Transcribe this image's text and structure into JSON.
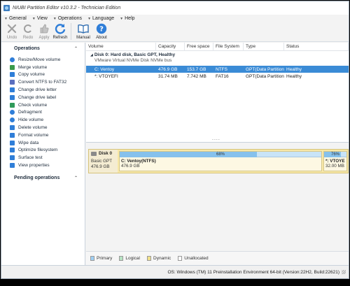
{
  "window": {
    "title": "NIUBI Partition Editor v10.3.2 - Technician Edition"
  },
  "menu": [
    {
      "label": "General"
    },
    {
      "label": "View"
    },
    {
      "label": "Operations"
    },
    {
      "label": "Language"
    },
    {
      "label": "Help"
    }
  ],
  "toolbar": {
    "undo": "Undo",
    "redo": "Redo",
    "apply": "Apply",
    "refresh": "Refresh",
    "manual": "Manual",
    "about": "About"
  },
  "operations_panel": {
    "title": "Operations",
    "items": [
      {
        "label": "Resize/Move volume",
        "color": "#2f7ed8"
      },
      {
        "label": "Merge volume",
        "color": "#3a9a4a"
      },
      {
        "label": "Copy volume",
        "color": "#2f7ed8"
      },
      {
        "label": "Convert NTFS to FAT32",
        "color": "#5a6fbf"
      },
      {
        "label": "Change drive letter",
        "color": "#2f7ed8"
      },
      {
        "label": "Change drive label",
        "color": "#2f7ed8"
      },
      {
        "label": "Check volume",
        "color": "#2f9a5a"
      },
      {
        "label": "Defragment",
        "color": "#2f7ed8"
      },
      {
        "label": "Hide volume",
        "color": "#2f7ed8"
      },
      {
        "label": "Delete volume",
        "color": "#2f7ed8"
      },
      {
        "label": "Format volume",
        "color": "#2f7ed8"
      },
      {
        "label": "Wipe data",
        "color": "#2f7ed8"
      },
      {
        "label": "Optimize filesystem",
        "color": "#2f7ed8"
      },
      {
        "label": "Surface test",
        "color": "#2f7ed8"
      },
      {
        "label": "View properties",
        "color": "#2f7ed8"
      }
    ]
  },
  "pending_panel": {
    "title": "Pending operations"
  },
  "table": {
    "columns": [
      "Volume",
      "Capacity",
      "Free space",
      "File System",
      "Type",
      "Status"
    ],
    "disk_title": "Disk 0: Hard disk, Basic GPT, Healthy",
    "disk_subtitle": "VMware Virtual NVMe Disk NVMe bus",
    "rows": [
      {
        "volume": "C: Ventoy",
        "capacity": "476.9 GB",
        "free": "153.7 GB",
        "fs": "NTFS",
        "type": "GPT(Data Partition)",
        "status": "Healthy",
        "selected": true
      },
      {
        "volume": "*: VTOYEFI",
        "capacity": "31.74 MB",
        "free": "7.742 MB",
        "fs": "FAT16",
        "type": "GPT(Data Partition)",
        "status": "Healthy",
        "selected": false
      }
    ],
    "dots": "...."
  },
  "disk_map": {
    "disk_name": "Disk 0",
    "disk_type": "Basic GPT",
    "disk_size": "476.9 GB",
    "partitions": [
      {
        "name": "C: Ventoy(NTFS)",
        "size": "476.9 GB",
        "usage_label": "68%",
        "usage": 0.68
      },
      {
        "name": "*: VTOYE",
        "size": "32.00 MB",
        "usage_label": "76%",
        "usage": 0.76
      }
    ]
  },
  "legend": [
    {
      "label": "Primary",
      "color": "#9fd0f5"
    },
    {
      "label": "Logical",
      "color": "#b7e3c4"
    },
    {
      "label": "Dynamic",
      "color": "#f1e18a"
    },
    {
      "label": "Unallocated",
      "color": "#ffffff"
    }
  ],
  "status": {
    "text": "OS: Windows (TM) 11 Preinstallation Environment 64-bit (Version:22H2, Build:22621)"
  }
}
